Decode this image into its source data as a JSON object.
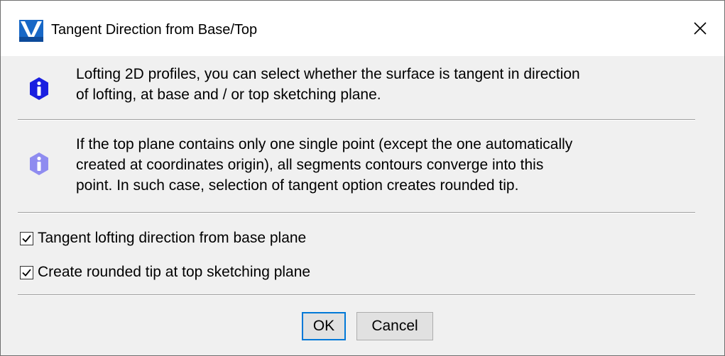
{
  "dialog": {
    "title": "Tangent Direction from Base/Top",
    "messages": [
      {
        "icon": "info-icon",
        "text": "Lofting 2D profiles, you can select whether the surface is tangent in direction\nof lofting, at base and / or top sketching plane."
      },
      {
        "icon": "info-icon-light",
        "text": "If the top plane contains only one single point (except the one automatically\ncreated at coordinates origin), all segments contours converge into this\npoint. In such case, selection of tangent option creates rounded tip."
      }
    ],
    "options": [
      {
        "label": "Tangent lofting direction from base plane",
        "checked": true
      },
      {
        "label": "Create rounded tip at top sketching plane",
        "checked": true
      }
    ],
    "buttons": {
      "ok": "OK",
      "cancel": "Cancel"
    },
    "colors": {
      "info_primary": "#1a1fe0",
      "info_secondary": "#8f8cf0",
      "focus_border": "#0078d7"
    }
  }
}
